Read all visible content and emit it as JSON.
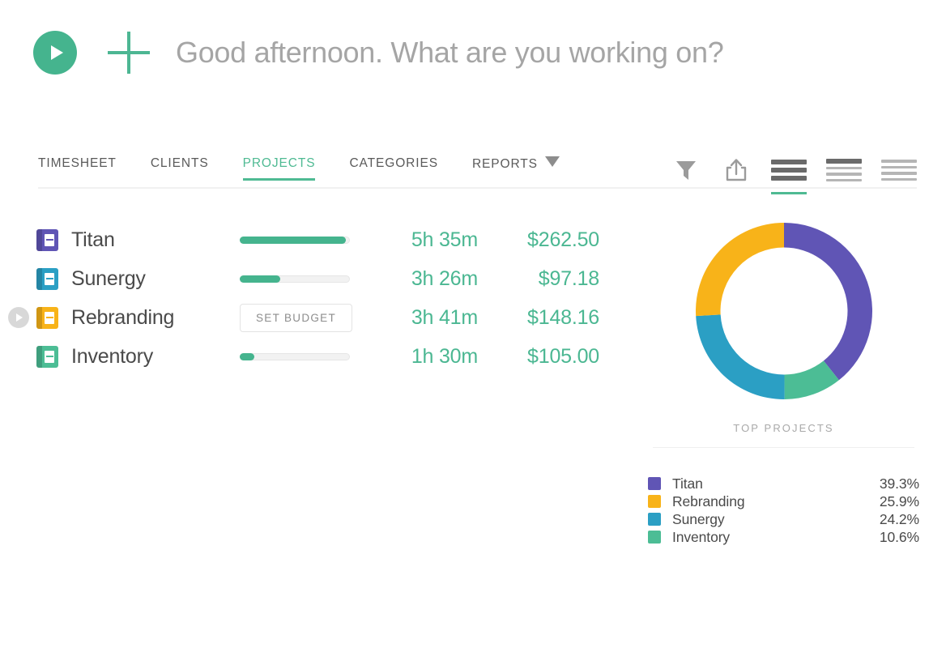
{
  "header": {
    "play_label": "start-timer",
    "add_label": "add-entry",
    "greeting_placeholder": "Good afternoon. What are you working on?",
    "greeting_value": ""
  },
  "nav": {
    "tabs": [
      {
        "label": "TIMESHEET",
        "active": false,
        "caret": false
      },
      {
        "label": "CLIENTS",
        "active": false,
        "caret": false
      },
      {
        "label": "PROJECTS",
        "active": true,
        "caret": false
      },
      {
        "label": "CATEGORIES",
        "active": false,
        "caret": false
      },
      {
        "label": "REPORTS",
        "active": false,
        "caret": true
      }
    ],
    "accent_color": "#4fba93"
  },
  "toolbar": {
    "filter_label": "Filter",
    "share_label": "Export",
    "views": [
      {
        "name": "comfortable-view",
        "active": true
      },
      {
        "name": "compact-view",
        "active": false
      },
      {
        "name": "list-view",
        "active": false
      }
    ]
  },
  "projects": [
    {
      "name": "Titan",
      "color": "#6055b5",
      "progress": 95,
      "has_budget": true,
      "time": "5h 35m",
      "amount": "$262.50",
      "running": false
    },
    {
      "name": "Sunergy",
      "color": "#2b9fc4",
      "progress": 35,
      "has_budget": true,
      "time": "3h 26m",
      "amount": "$97.18",
      "running": false
    },
    {
      "name": "Rebranding",
      "color": "#f8b319",
      "progress": 0,
      "has_budget": false,
      "budget_button_label": "SET BUDGET",
      "time": "3h 41m",
      "amount": "$148.16",
      "running": true
    },
    {
      "name": "Inventory",
      "color": "#4cbd95",
      "progress": 12,
      "has_budget": true,
      "time": "1h 30m",
      "amount": "$105.00",
      "running": false
    }
  ],
  "panel": {
    "title": "TOP PROJECTS"
  },
  "chart_data": {
    "type": "pie",
    "title": "TOP PROJECTS",
    "donut": true,
    "inner_radius_ratio": 0.72,
    "start_angle_deg": -90,
    "direction": "clockwise",
    "legend_position": "bottom",
    "categories": [
      "Titan",
      "Inventory",
      "Sunergy",
      "Rebranding"
    ],
    "slices": [
      {
        "label": "Titan",
        "value": 39.3,
        "display": "39.3%",
        "color": "#6055b5"
      },
      {
        "label": "Inventory",
        "value": 10.6,
        "display": "10.6%",
        "color": "#4cbd95"
      },
      {
        "label": "Sunergy",
        "value": 24.2,
        "display": "24.2%",
        "color": "#2b9fc4"
      },
      {
        "label": "Rebranding",
        "value": 25.9,
        "display": "25.9%",
        "color": "#f8b319"
      }
    ],
    "legend": [
      {
        "label": "Titan",
        "display": "39.3%",
        "color": "#6055b5"
      },
      {
        "label": "Rebranding",
        "display": "25.9%",
        "color": "#f8b319"
      },
      {
        "label": "Sunergy",
        "display": "24.2%",
        "color": "#2b9fc4"
      },
      {
        "label": "Inventory",
        "display": "10.6%",
        "color": "#4cbd95"
      }
    ]
  }
}
